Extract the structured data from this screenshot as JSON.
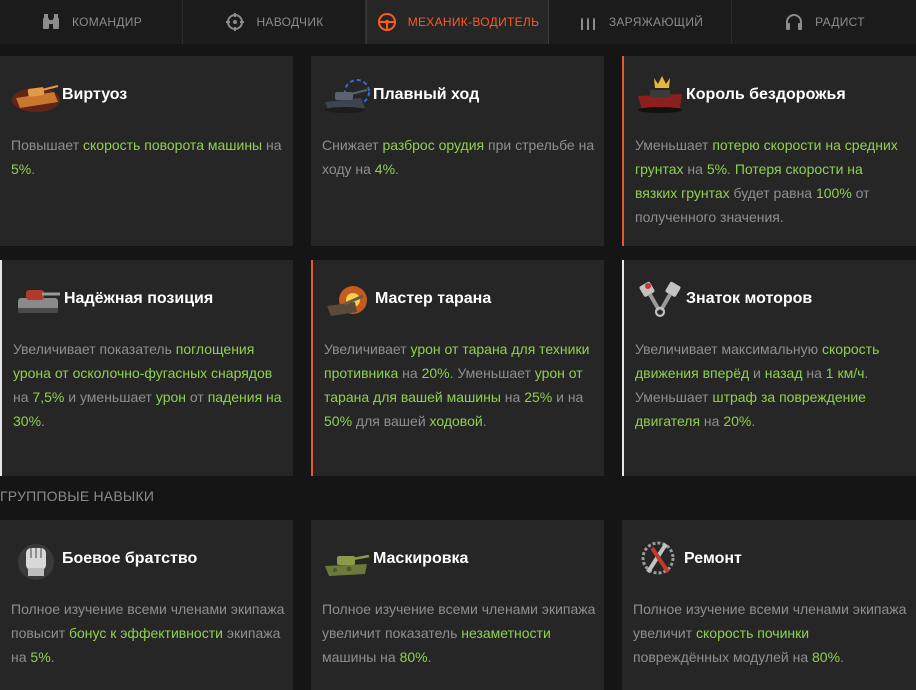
{
  "tabs": [
    {
      "label": "КОМАНДИР",
      "icon": "binoculars-icon",
      "active": false
    },
    {
      "label": "НАВОДЧИК",
      "icon": "crosshair-icon",
      "active": false
    },
    {
      "label": "МЕХАНИК-ВОДИТЕЛЬ",
      "icon": "steering-wheel-icon",
      "active": true
    },
    {
      "label": "ЗАРЯЖАЮЩИЙ",
      "icon": "shells-icon",
      "active": false
    },
    {
      "label": "РАДИСТ",
      "icon": "headphones-icon",
      "active": false
    }
  ],
  "colors": {
    "accent": "#ff5a1f",
    "highlight": "#8fd14f",
    "text": "#8f8f8f",
    "card": "#262626"
  },
  "skills": [
    {
      "title": "Виртуоз",
      "icon": "tank-turning-icon",
      "desc": [
        {
          "t": "Повышает "
        },
        {
          "t": "скорость поворота машины",
          "h": true
        },
        {
          "t": " на "
        },
        {
          "t": "5%",
          "h": true
        },
        {
          "t": "."
        }
      ]
    },
    {
      "title": "Плавный ход",
      "icon": "tank-aim-icon",
      "desc": [
        {
          "t": "Снижает "
        },
        {
          "t": "разброс орудия",
          "h": true
        },
        {
          "t": " при стрельбе на ходу на "
        },
        {
          "t": "4%",
          "h": true
        },
        {
          "t": "."
        }
      ]
    },
    {
      "title": "Король бездорожья",
      "icon": "crown-tank-icon",
      "desc": [
        {
          "t": "Уменьшает "
        },
        {
          "t": "потерю скорости на средних грунтах",
          "h": true
        },
        {
          "t": " на "
        },
        {
          "t": "5%",
          "h": true
        },
        {
          "t": ". "
        },
        {
          "t": "Потеря скорости на вязких грунтах",
          "h": true
        },
        {
          "t": " будет равна "
        },
        {
          "t": "100%",
          "h": true
        },
        {
          "t": " от полученного значения."
        }
      ]
    },
    {
      "title": "Надёжная позиция",
      "icon": "armored-tank-icon",
      "desc": [
        {
          "t": "Увеличивает показатель "
        },
        {
          "t": "поглощения урона от осколочно-фугасных снарядов",
          "h": true
        },
        {
          "t": " на "
        },
        {
          "t": "7,5%",
          "h": true
        },
        {
          "t": " и уменьшает "
        },
        {
          "t": "урон",
          "h": true
        },
        {
          "t": " от "
        },
        {
          "t": "падения на 30%",
          "h": true
        },
        {
          "t": "."
        }
      ]
    },
    {
      "title": "Мастер тарана",
      "icon": "ram-explosion-icon",
      "desc": [
        {
          "t": "Увеличивает "
        },
        {
          "t": "урон от тарана для техники противника",
          "h": true
        },
        {
          "t": " на "
        },
        {
          "t": "20%",
          "h": true
        },
        {
          "t": ". Уменьшает "
        },
        {
          "t": "урон от тарана для вашей машины",
          "h": true
        },
        {
          "t": " на "
        },
        {
          "t": "25%",
          "h": true
        },
        {
          "t": " и на "
        },
        {
          "t": "50%",
          "h": true
        },
        {
          "t": " для вашей "
        },
        {
          "t": "ходовой",
          "h": true
        },
        {
          "t": "."
        }
      ]
    },
    {
      "title": "Знаток моторов",
      "icon": "pistons-icon",
      "desc": [
        {
          "t": "Увеличивает максимальную "
        },
        {
          "t": "скорость движения вперёд",
          "h": true
        },
        {
          "t": " и "
        },
        {
          "t": "назад",
          "h": true
        },
        {
          "t": " на "
        },
        {
          "t": "1 км/ч",
          "h": true
        },
        {
          "t": ". Уменьшает "
        },
        {
          "t": "штраф за повреждение двигателя",
          "h": true
        },
        {
          "t": " на "
        },
        {
          "t": "20%",
          "h": true
        },
        {
          "t": "."
        }
      ]
    }
  ],
  "group_label": "ГРУППОВЫЕ НАВЫКИ",
  "group_skills": [
    {
      "title": "Боевое братство",
      "icon": "fist-icon",
      "desc": [
        {
          "t": "Полное изучение всеми членами экипажа повысит "
        },
        {
          "t": "бонус к эффективности",
          "h": true
        },
        {
          "t": " экипажа на "
        },
        {
          "t": "5%",
          "h": true
        },
        {
          "t": "."
        }
      ]
    },
    {
      "title": "Маскировка",
      "icon": "camo-tank-icon",
      "desc": [
        {
          "t": "Полное изучение всеми членами экипажа увеличит показатель "
        },
        {
          "t": "незаметности",
          "h": true
        },
        {
          "t": " машины на "
        },
        {
          "t": "80%",
          "h": true
        },
        {
          "t": "."
        }
      ]
    },
    {
      "title": "Ремонт",
      "icon": "wrench-screwdriver-icon",
      "desc": [
        {
          "t": "Полное изучение всеми членами экипажа увеличит "
        },
        {
          "t": "скорость починки",
          "h": true
        },
        {
          "t": " повреждённых модулей на "
        },
        {
          "t": "80%",
          "h": true
        },
        {
          "t": "."
        }
      ]
    }
  ]
}
